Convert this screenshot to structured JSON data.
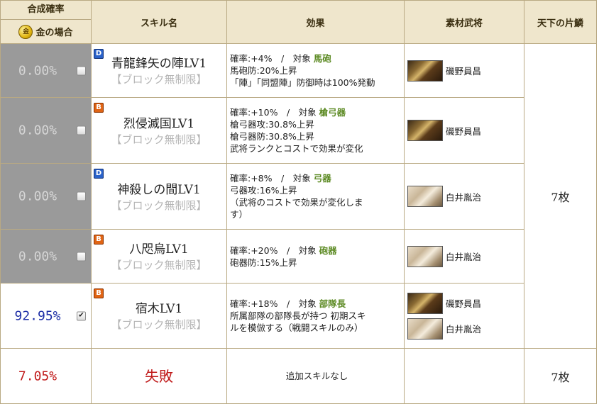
{
  "header": {
    "rate_title": "合成確率",
    "gold_case": "金の場合",
    "coin_glyph": "金",
    "skill_name": "スキル名",
    "effect": "効果",
    "material": "素材武将",
    "shards": "天下の片鱗"
  },
  "rows": [
    {
      "rate": "0.00%",
      "checked": false,
      "badge": "D",
      "name": "青龍鋒矢の陣LV1",
      "block": "【ブロック無制限】",
      "effect": [
        "確率:+4%　/　対象",
        "馬砲防:20%上昇",
        "「陣」「同盟陣」防御時は100%発動"
      ],
      "target": "馬砲",
      "materials": [
        {
          "portrait": "armor-general-portrait",
          "name": "磯野員昌"
        }
      ]
    },
    {
      "rate": "0.00%",
      "checked": false,
      "badge": "B",
      "name": "烈侵滅国LV1",
      "block": "【ブロック無制限】",
      "effect": [
        "確率:+10%　/　対象",
        "槍弓器攻:30.8%上昇",
        "槍弓器防:30.8%上昇",
        "武将ランクとコストで効果が変化"
      ],
      "target": "槍弓器",
      "materials": [
        {
          "portrait": "armor-general-portrait",
          "name": "磯野員昌"
        }
      ]
    },
    {
      "rate": "0.00%",
      "checked": false,
      "badge": "D",
      "name": "神殺しの間LV1",
      "block": "【ブロック無制限】",
      "effect": [
        "確率:+8%　/　対象",
        "弓器攻:16%上昇",
        "（武将のコストで効果が変化しま",
        "す）"
      ],
      "target": "弓器",
      "materials": [
        {
          "portrait": "elder-general-portrait",
          "name": "白井胤治"
        }
      ]
    },
    {
      "rate": "0.00%",
      "checked": false,
      "badge": "B",
      "name": "八咫烏LV1",
      "block": "【ブロック無制限】",
      "effect": [
        "確率:+20%　/　対象",
        "砲器防:15%上昇"
      ],
      "target": "砲器",
      "materials": [
        {
          "portrait": "elder-general-portrait",
          "name": "白井胤治"
        }
      ]
    },
    {
      "rate": "92.95%",
      "checked": true,
      "badge": "B",
      "name": "宿木LV1",
      "block": "【ブロック無制限】",
      "effect": [
        "確率:+18%　/　対象",
        "所属部隊の部隊長が持つ 初期スキ",
        "ルを模倣する（戦闘スキルのみ）"
      ],
      "target": "部隊長",
      "materials": [
        {
          "portrait": "armor-general-portrait",
          "name": "磯野員昌"
        },
        {
          "portrait": "elder-general-portrait",
          "name": "白井胤治"
        }
      ]
    }
  ],
  "shards_value": "7枚",
  "fail_row": {
    "rate": "7.05%",
    "name": "失敗",
    "effect": "追加スキルなし",
    "shards": "7枚"
  },
  "colors": {
    "header_bg": "#efe6cc",
    "grey_rate_bg": "#9a9a9a",
    "success_rate": "#1d2ea6",
    "fail_rate": "#c01a1a",
    "target_green": "#5c8a23",
    "badge_D": "#2a62c9",
    "badge_B": "#e06414"
  }
}
